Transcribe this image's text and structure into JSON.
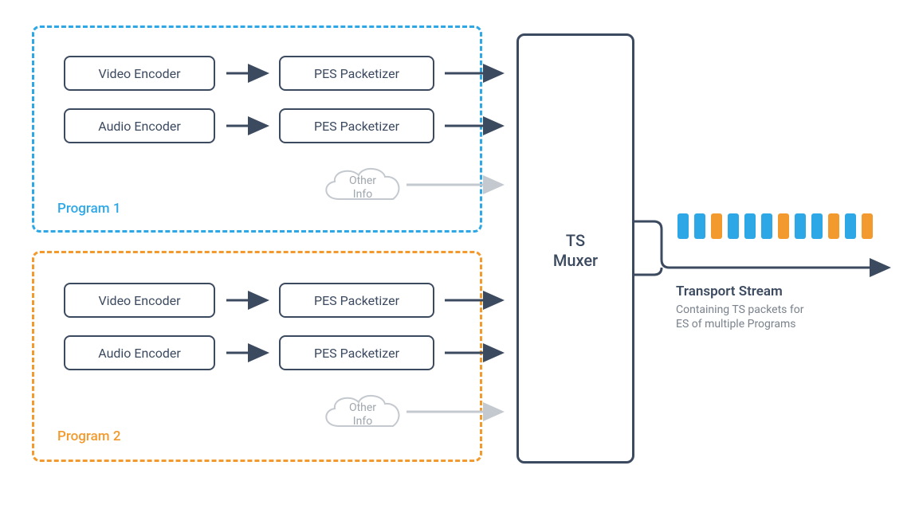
{
  "program1": {
    "label": "Program 1",
    "color": "#2ea7e6",
    "video_encoder": "Video Encoder",
    "audio_encoder": "Audio Encoder",
    "pes1": "PES Packetizer",
    "pes2": "PES Packetizer",
    "other_info_l1": "Other",
    "other_info_l2": "Info"
  },
  "program2": {
    "label": "Program 2",
    "color": "#f29a2e",
    "video_encoder": "Video Encoder",
    "audio_encoder": "Audio Encoder",
    "pes1": "PES Packetizer",
    "pes2": "PES Packetizer",
    "other_info_l1": "Other",
    "other_info_l2": "Info"
  },
  "muxer": {
    "line1": "TS",
    "line2": "Muxer"
  },
  "output": {
    "title": "Transport Stream",
    "sub_l1": "Containing TS packets for",
    "sub_l2": "ES of multiple Programs",
    "packet_colors": [
      "blue",
      "blue",
      "orange",
      "blue",
      "blue",
      "blue",
      "orange",
      "blue",
      "blue",
      "orange",
      "blue",
      "orange"
    ]
  },
  "arrow_color_dark": "#3c4a60",
  "arrow_color_light": "#c4c9cf"
}
